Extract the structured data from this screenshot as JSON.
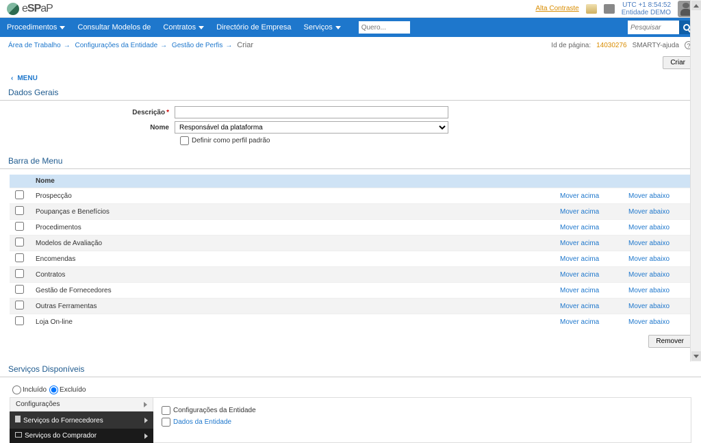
{
  "brand": {
    "e": "e",
    "sp": "SP",
    "ap": "aP"
  },
  "header": {
    "orange_link": "Alta Contraste",
    "clock_line1": "UTC +1 8:54:52",
    "clock_line2": "Entidade DEMO"
  },
  "nav": {
    "items": [
      "Procedimentos",
      "Consultar Modelos de",
      "Contratos",
      "Directório de Empresa",
      "Serviços"
    ],
    "quero_placeholder": "Quero...",
    "search_placeholder": "Pesquisar"
  },
  "crumbs": {
    "c1": "Área de Trabalho",
    "c2": "Configurações da Entidade",
    "c3": "Gestão de Perfis",
    "current": "Criar",
    "id_label": "Id de página:",
    "id_value": "14030276",
    "smarty": "SMARTY-ajuda"
  },
  "buttons": {
    "criar": "Criar",
    "remover": "Remover"
  },
  "menu_link": "MENU",
  "sections": {
    "dados": "Dados Gerais",
    "barra": "Barra de Menu",
    "servicos": "Serviços Disponíveis"
  },
  "form": {
    "descricao_label": "Descrição",
    "nome_label": "Nome",
    "nome_value": "Responsável da plataforma",
    "definir_label": "Definir como perfil padrão"
  },
  "table": {
    "header_nome": "Nome",
    "mover_acima": "Mover acima",
    "mover_abaixo": "Mover abaixo",
    "rows": [
      "Prospecção",
      "Poupanças e Benefícios",
      "Procedimentos",
      "Modelos de Avaliação",
      "Encomendas",
      "Contratos",
      "Gestão de Fornecedores",
      "Outras Ferramentas",
      "Loja On-line"
    ]
  },
  "services": {
    "radio_incluido": "Incluído",
    "radio_excluido": "Excluído",
    "left": {
      "config": "Configurações",
      "forn": "Serviços do Fornecedores",
      "comp": "Serviços do Comprador"
    },
    "right": {
      "cfg_ent": "Configurações da Entidade",
      "dados_ent": "Dados da Entidade"
    }
  }
}
